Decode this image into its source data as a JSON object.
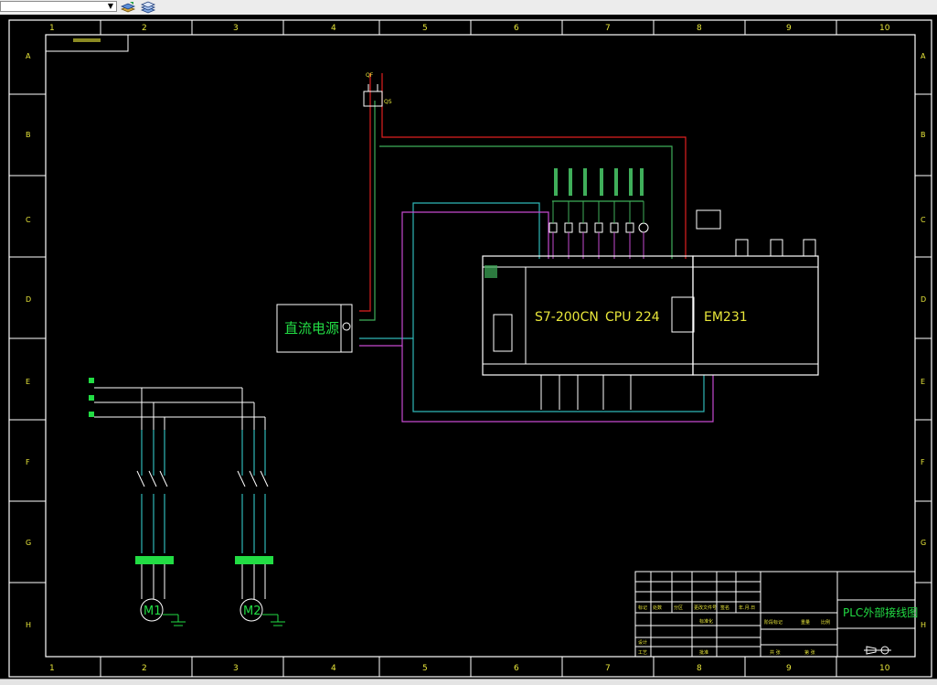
{
  "toolbar": {
    "layer_value": "",
    "icons": [
      "layer-state-icon",
      "layer-properties-icon"
    ]
  },
  "drawing": {
    "border_columns": [
      "1",
      "2",
      "3",
      "4",
      "5",
      "6",
      "7",
      "8",
      "9",
      "10"
    ],
    "border_rows": [
      "A",
      "B",
      "C",
      "D",
      "E",
      "F",
      "G",
      "H"
    ],
    "psu_label": "直流电源",
    "plc_model": "S7-200CN",
    "cpu_model": "CPU 224",
    "expansion_module": "EM231",
    "motor1_label": "M1",
    "motor2_label": "M2",
    "title_block_name": "PLC外部接线图",
    "title_block_small": [
      "设计",
      "审核",
      "标准化",
      "批准",
      "工艺",
      "日期",
      "共 张",
      "第 张",
      "比例",
      "重量",
      "阶段标记",
      "更改文件号",
      "签名",
      "年.月.日",
      "处数",
      "分区",
      "标记"
    ]
  },
  "colors": {
    "background": "#000000",
    "border_lines": "#ffffff",
    "power_red": "#e02020",
    "wire_green": "#3fae5a",
    "wire_cyan": "#2fb7b7",
    "wire_magenta": "#c54ad0",
    "label_green": "#22dd44",
    "label_yellow": "#e8e63a"
  }
}
